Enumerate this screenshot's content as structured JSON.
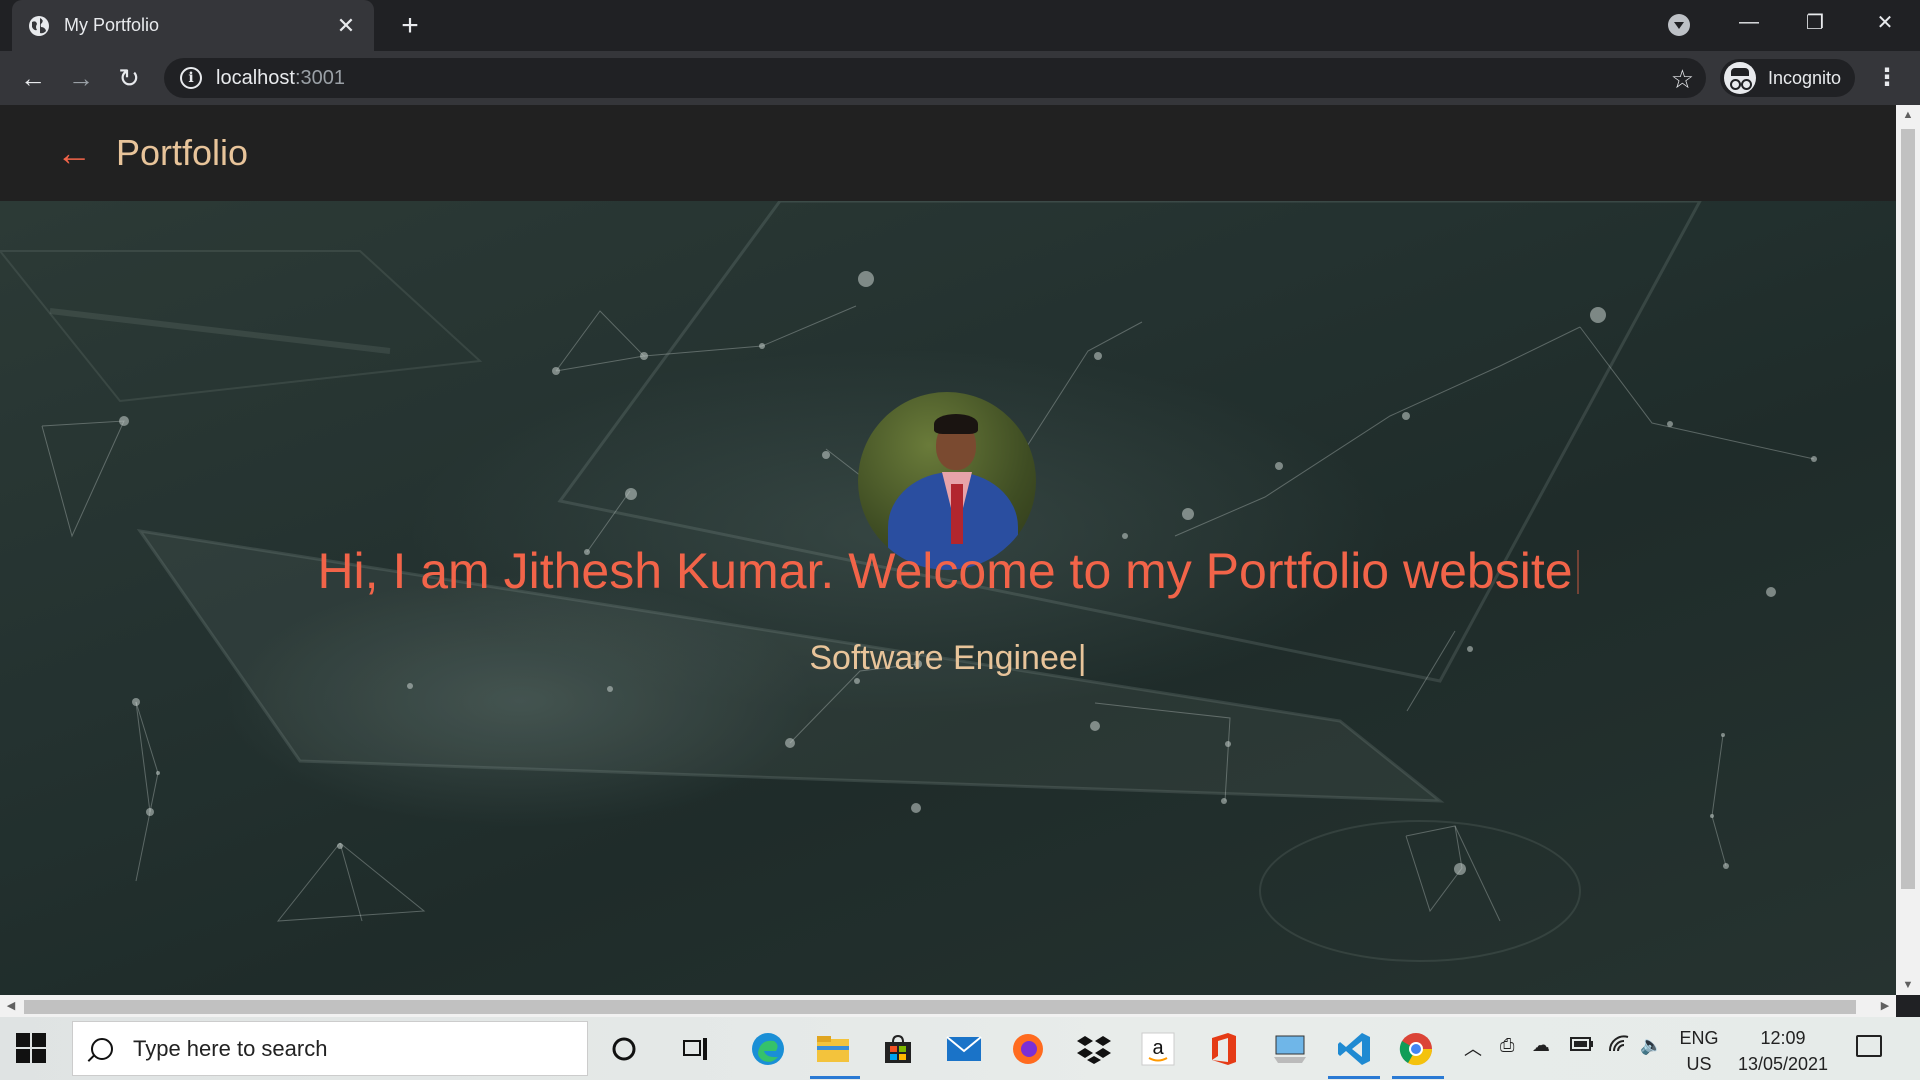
{
  "browser": {
    "tab_title": "My Portfolio",
    "url_host": "localhost",
    "url_port": ":3001",
    "profile_label": "Incognito"
  },
  "app": {
    "brand": "Portfolio",
    "headline": "Hi, I am Jithesh Kumar. Welcome to my Portfolio website",
    "subline": "Software Enginee|"
  },
  "taskbar": {
    "search_placeholder": "Type here to search",
    "lang_top": "ENG",
    "lang_bottom": "US",
    "time": "12:09",
    "date": "13/05/2021",
    "pinned": [
      "cortana-icon",
      "task-view-icon",
      "edge-icon",
      "file-explorer-icon",
      "store-icon",
      "mail-icon",
      "firefox-icon",
      "dropbox-icon",
      "amazon-icon",
      "office-icon",
      "this-pc-icon",
      "vscode-icon",
      "chrome-icon"
    ]
  },
  "colors": {
    "accent": "#f26449",
    "brand_text": "#e8c49a",
    "appbar": "#212121",
    "hero_overlay": "#243230"
  }
}
